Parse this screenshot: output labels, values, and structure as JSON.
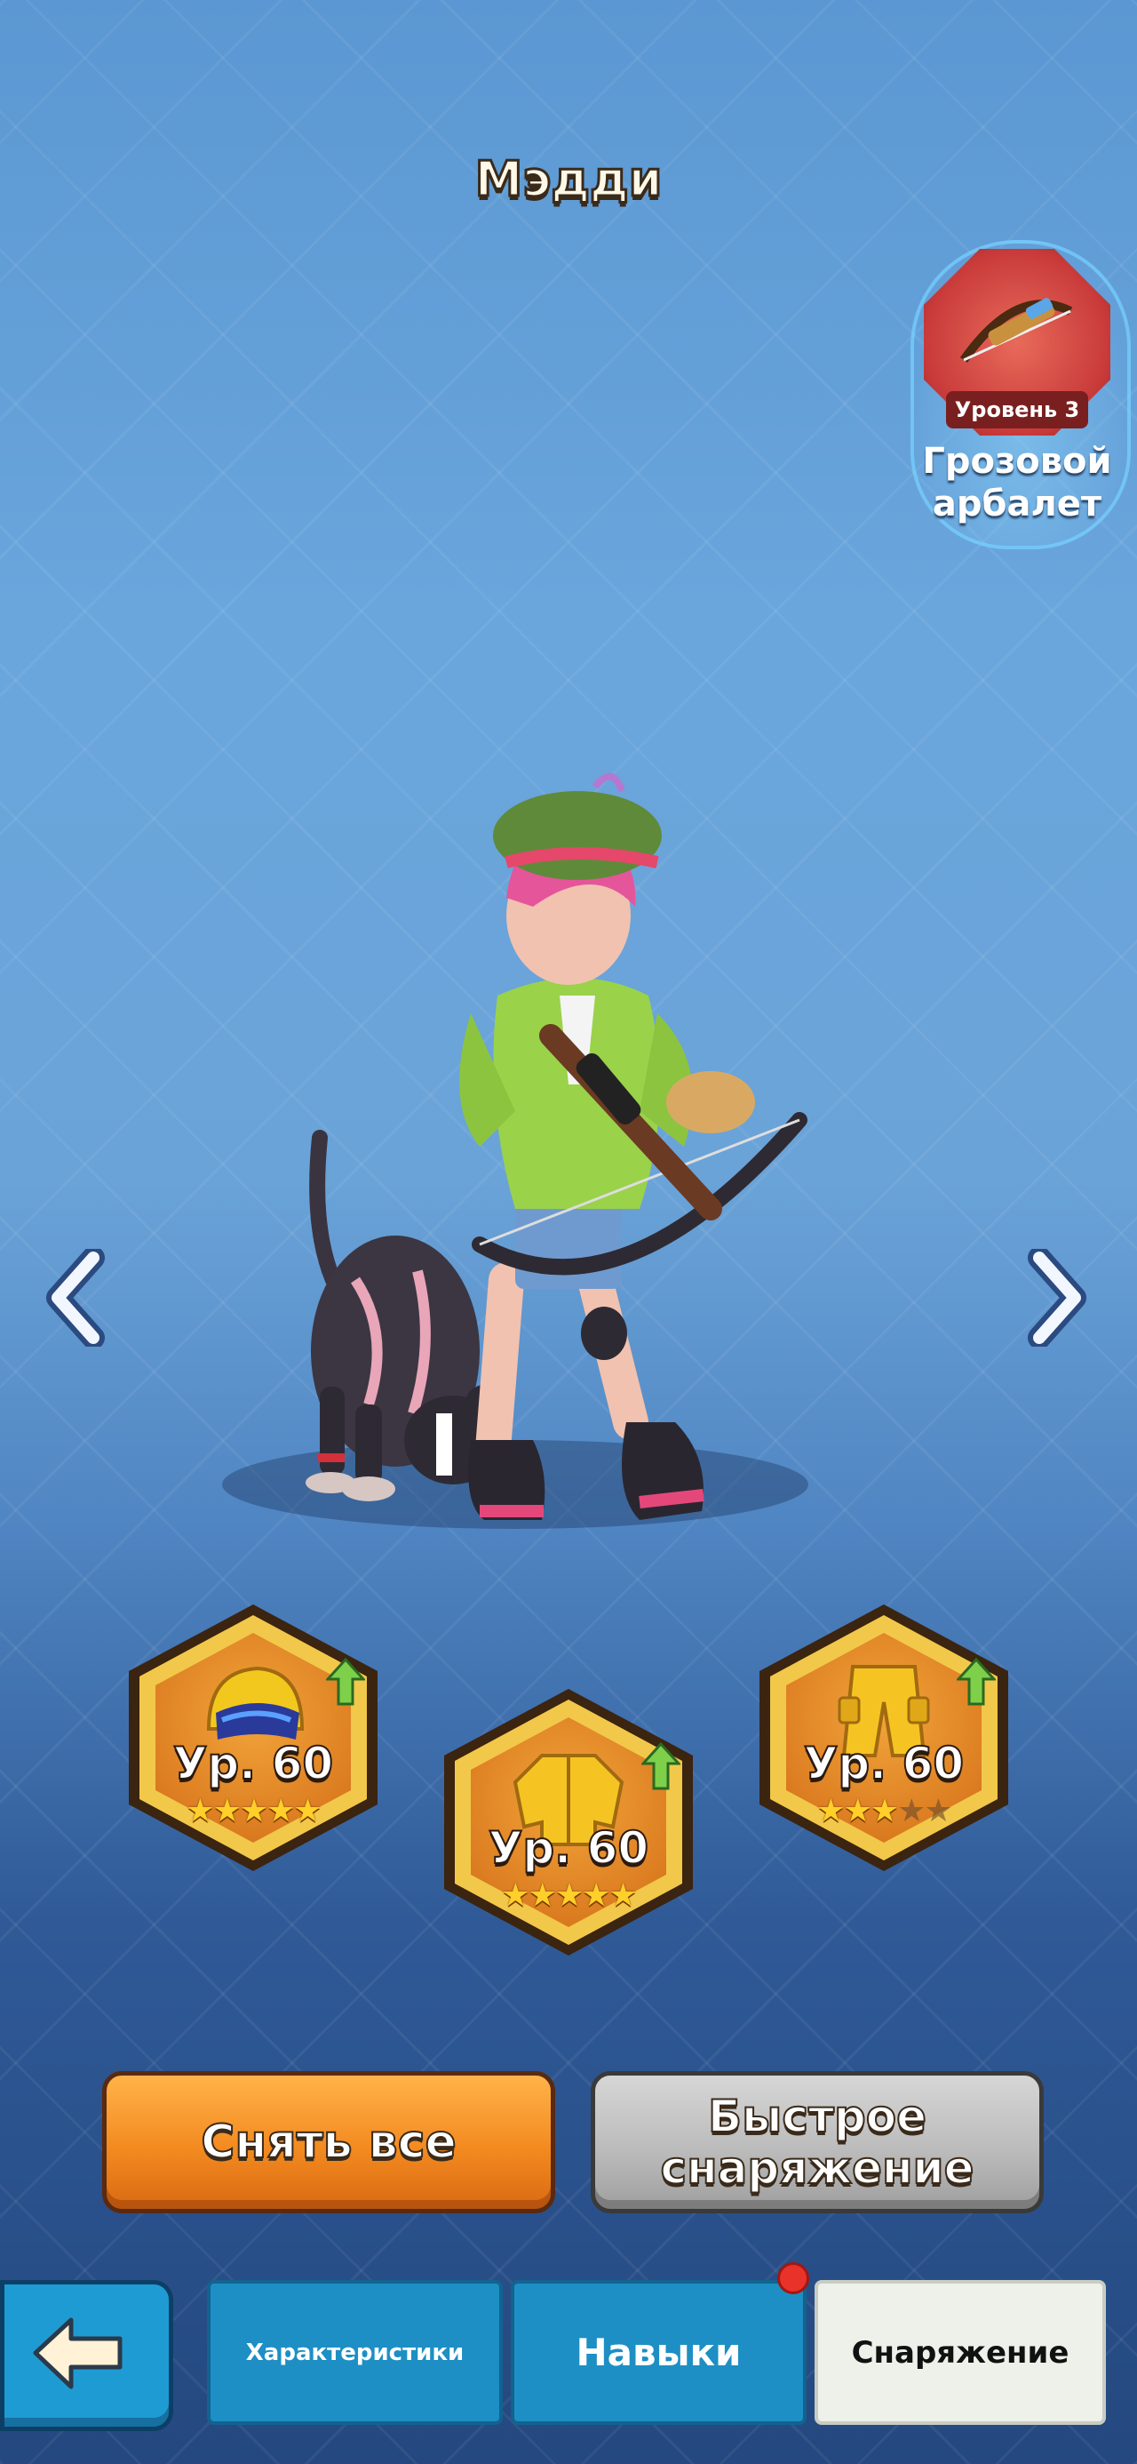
{
  "hero": {
    "name": "Мэдди"
  },
  "weapon": {
    "level_label": "Уровень 3",
    "name_line1": "Грозовой",
    "name_line2": "арбалет"
  },
  "gear": [
    {
      "slot": "helmet-icon",
      "level": "Ур. 60",
      "stars": 5,
      "max_stars": 5
    },
    {
      "slot": "jacket-icon",
      "level": "Ур. 60",
      "stars": 5,
      "max_stars": 5
    },
    {
      "slot": "pants-icon",
      "level": "Ур. 60",
      "stars": 3,
      "max_stars": 5
    }
  ],
  "buttons": {
    "remove_all": "Снять все",
    "quick_equip_line1": "Быстрое",
    "quick_equip_line2": "снаряжение"
  },
  "tabs": [
    {
      "label": "Характеристики"
    },
    {
      "label": "Навыки"
    },
    {
      "label": "Снаряжение"
    }
  ],
  "colors": {
    "accent_orange": "#f38a20",
    "tab_blue": "#1d8fc4",
    "notification_red": "#e8322a"
  }
}
